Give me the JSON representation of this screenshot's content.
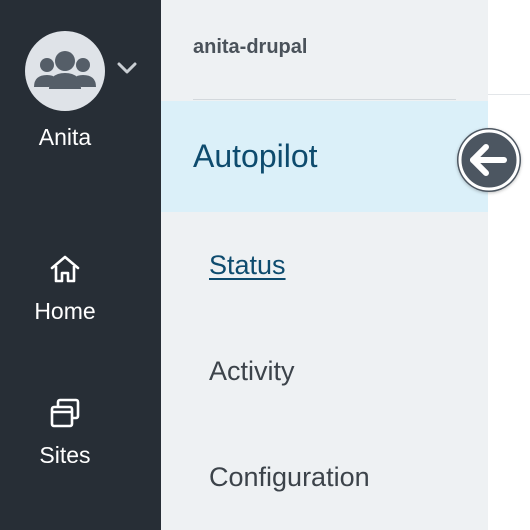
{
  "user": {
    "name": "Anita",
    "avatar_icon": "users-group-icon"
  },
  "rail": {
    "items": [
      {
        "label": "Home",
        "icon": "home-icon"
      },
      {
        "label": "Sites",
        "icon": "sites-icon"
      }
    ]
  },
  "subnav": {
    "site_name": "anita-drupal",
    "section_title": "Autopilot",
    "links": [
      {
        "label": "Status",
        "active": true
      },
      {
        "label": "Activity",
        "active": false
      },
      {
        "label": "Configuration",
        "active": false
      }
    ]
  },
  "colors": {
    "rail_bg": "#272e36",
    "subnav_bg": "#eef1f3",
    "active_bg": "#dbf0f9",
    "accent": "#0d4b6e"
  }
}
